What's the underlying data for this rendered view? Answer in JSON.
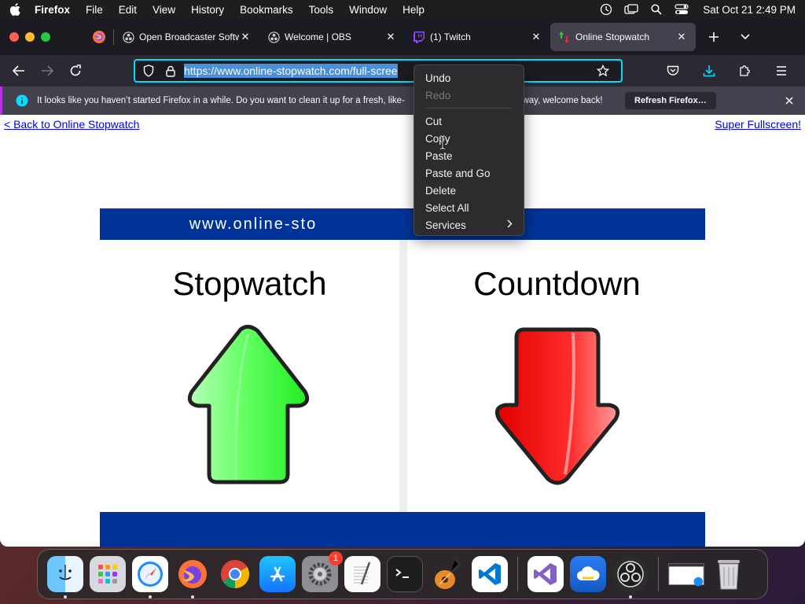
{
  "menubar": {
    "apple_icon": "apple-icon",
    "app_name": "Firefox",
    "items": [
      "File",
      "Edit",
      "View",
      "History",
      "Bookmarks",
      "Tools",
      "Window",
      "Help"
    ],
    "status_icons": [
      "time-machine-icon",
      "screen-mirroring-icon",
      "spotlight-search-icon",
      "control-center-icon"
    ],
    "clock": "Sat Oct 21  2:49 PM"
  },
  "tabs": [
    {
      "title": "Open Broadcaster Softw",
      "icon": "obs-icon",
      "active": false
    },
    {
      "title": "Welcome | OBS",
      "icon": "obs-icon",
      "active": false
    },
    {
      "title": "(1) Twitch",
      "icon": "twitch-icon",
      "active": false
    },
    {
      "title": "Online Stopwatch",
      "icon": "stopwatch-favicon",
      "active": true
    }
  ],
  "navbar": {
    "url": "https://www.online-stopwatch.com/full-scree",
    "url_selected": true
  },
  "infobar": {
    "text": "It looks like you haven’t started Firefox in a while. Do you want to clean it up for a fresh, like-",
    "text_tail": "e way, welcome back!",
    "button": "Refresh Firefox…"
  },
  "page": {
    "back_link": "< Back to Online Stopwatch",
    "super_link": "Super Fullscreen!",
    "banner": "www.online-sto",
    "left_title": "Stopwatch",
    "right_title": "Countdown",
    "colors": {
      "banner": "#003399",
      "up_arrow": "#33ff33",
      "down_arrow": "#ff1a1a"
    }
  },
  "context_menu": {
    "items": [
      {
        "label": "Undo",
        "enabled": true
      },
      {
        "label": "Redo",
        "enabled": false
      },
      {
        "separator": true
      },
      {
        "label": "Cut",
        "enabled": true
      },
      {
        "label": "Copy",
        "enabled": true
      },
      {
        "label": "Paste",
        "enabled": true
      },
      {
        "label": "Paste and Go",
        "enabled": true
      },
      {
        "label": "Delete",
        "enabled": true
      },
      {
        "label": "Select All",
        "enabled": true
      },
      {
        "label": "Services",
        "enabled": true,
        "submenu": true
      }
    ]
  },
  "dock": {
    "apps": [
      "finder",
      "launchpad",
      "safari",
      "firefox",
      "chrome",
      "app-store",
      "system-settings",
      "textedit",
      "terminal",
      "garageband",
      "vscode",
      "visual-studio",
      "cloudmounter",
      "obs",
      "preview-window",
      "trash"
    ],
    "settings_badge": "1"
  }
}
